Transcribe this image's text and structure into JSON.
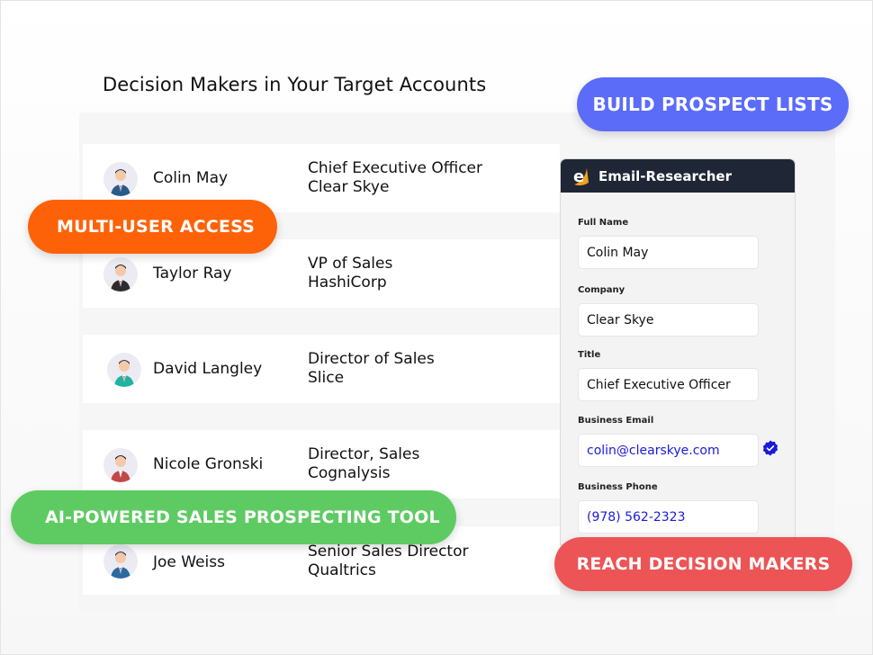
{
  "heading": "Decision Makers in Your Target Accounts",
  "badges": {
    "build": "BUILD PROSPECT LISTS",
    "multi": "MULTI-USER ACCESS",
    "ai": "AI-POWERED SALES PROSPECTING TOOL",
    "reach": "REACH DECISION MAKERS"
  },
  "colors": {
    "build": "#5b6cf9",
    "multi": "#fe6208",
    "ai": "#5ecb62",
    "reach": "#ec5456",
    "panel_header": "#1f2636",
    "link_blue": "#1a1adb"
  },
  "contacts": [
    {
      "name": "Colin May",
      "title": "Chief Executive Officer",
      "company": "Clear Skye",
      "avatar": "male-navy-suit-avatar"
    },
    {
      "name": "Taylor Ray",
      "title": "VP of Sales",
      "company": "HashiCorp",
      "avatar": "male-dark-suit-avatar"
    },
    {
      "name": "David Langley",
      "title": "Director of Sales",
      "company": "Slice",
      "avatar": "male-teal-suit-avatar"
    },
    {
      "name": "Nicole Gronski",
      "title": "Director, Sales",
      "company": "Cognalysis",
      "avatar": "male-red-shirt-avatar"
    },
    {
      "name": "Joe Weiss",
      "title": "Senior Sales Director",
      "company": "Qualtrics",
      "avatar": "male-blue-suit-avatar"
    }
  ],
  "researcher": {
    "title": "Email-Researcher",
    "logo": "email-researcher-logo",
    "fields": {
      "full_name": {
        "label": "Full Name",
        "value": "Colin May"
      },
      "company": {
        "label": "Company",
        "value": "Clear Skye"
      },
      "title": {
        "label": "Title",
        "value": "Chief Executive Officer"
      },
      "email": {
        "label": "Business Email",
        "value": "colin@clearskye.com",
        "verified_icon": "verified-badge-icon"
      },
      "phone": {
        "label": "Business Phone",
        "value": "(978) 562-2323"
      }
    }
  }
}
